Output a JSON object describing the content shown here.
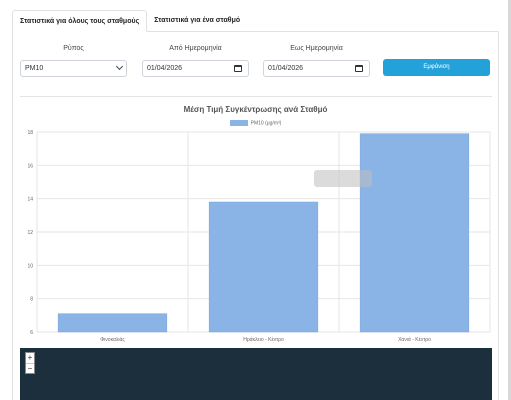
{
  "tabs": [
    {
      "label": "Στατιστικά για όλους τους σταθμούς",
      "active": true
    },
    {
      "label": "Στατιστικά για ένα σταθμό",
      "active": false
    }
  ],
  "filters": {
    "pollutant_label": "Ρύπος",
    "pollutant_value": "PM10",
    "from_label": "Από Ημερομηνία",
    "from_value": "01/04/2026",
    "to_label": "Εως Ημερομηνία",
    "to_value": "01/04/2026",
    "show_button": "Εμφάνιση"
  },
  "map": {
    "zoom_in": "+",
    "zoom_out": "−"
  },
  "colors": {
    "accent": "#23a2da",
    "bar": "#8ab4e6",
    "bar_border": "#7aa6dc",
    "map_bg": "#1c2f3c"
  },
  "chart_data": {
    "type": "bar",
    "title": "Μέση Τιμή Συγκέντρωσης ανά Σταθμό",
    "categories": [
      "Φινοκαλιάς",
      "Ηράκλειο - Κέντρο",
      "Χανιά - Κέντρο"
    ],
    "series": [
      {
        "name": "PM10 (μg/m³)",
        "values": [
          7.1,
          13.8,
          17.9
        ]
      }
    ],
    "ylim": [
      6,
      18
    ],
    "yticks": [
      6,
      8,
      10,
      12,
      14,
      16,
      18
    ],
    "grid": true,
    "legend": "top"
  }
}
